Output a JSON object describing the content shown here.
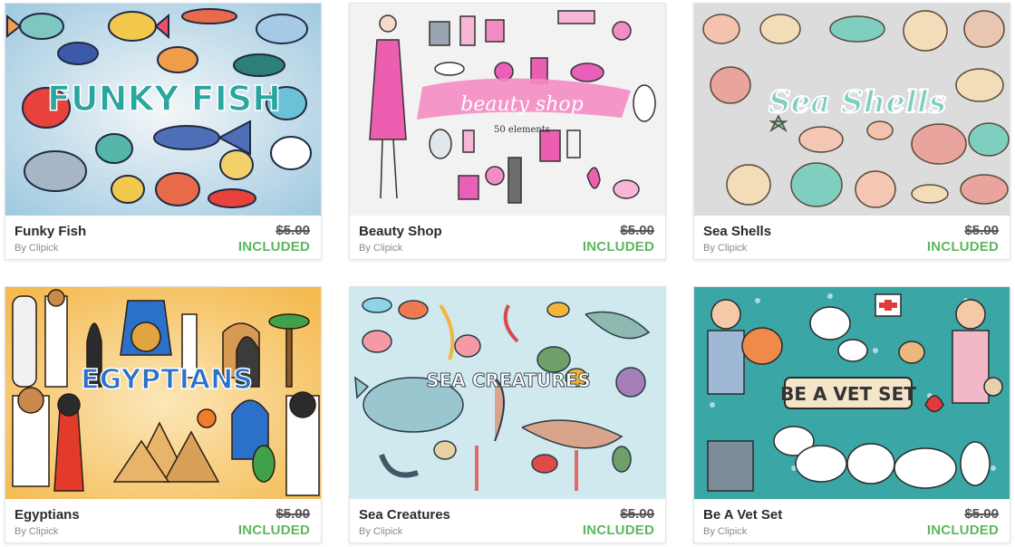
{
  "colors": {
    "included": "#5cb85c",
    "price": "#555555",
    "author": "#8a8a8a"
  },
  "products": [
    {
      "thumb_text": "FUNKY FISH",
      "name": "Funky Fish",
      "author": "By Clipick",
      "old_price": "$5.00",
      "status": "INCLUDED",
      "bg": "#cfe3ef"
    },
    {
      "thumb_text": "beauty shop",
      "thumb_sub": "50 elements",
      "name": "Beauty Shop",
      "author": "By Clipick",
      "old_price": "$5.00",
      "status": "INCLUDED",
      "bg": "#f2f2f2"
    },
    {
      "thumb_text": "Sea Shells",
      "name": "Sea Shells",
      "author": "By Clipick",
      "old_price": "$5.00",
      "status": "INCLUDED",
      "bg": "#dcdcdc"
    },
    {
      "thumb_text": "EGYPTIANS",
      "name": "Egyptians",
      "author": "By Clipick",
      "old_price": "$5.00",
      "status": "INCLUDED",
      "bg": "#f6cd6e"
    },
    {
      "thumb_text": "SEA CREATURES",
      "name": "Sea Creatures",
      "author": "By Clipick",
      "old_price": "$5.00",
      "status": "INCLUDED",
      "bg": "#cfe9ef"
    },
    {
      "thumb_text": "BE A VET SET",
      "name": "Be A Vet Set",
      "author": "By Clipick",
      "old_price": "$5.00",
      "status": "INCLUDED",
      "bg": "#3aa6a6"
    }
  ]
}
